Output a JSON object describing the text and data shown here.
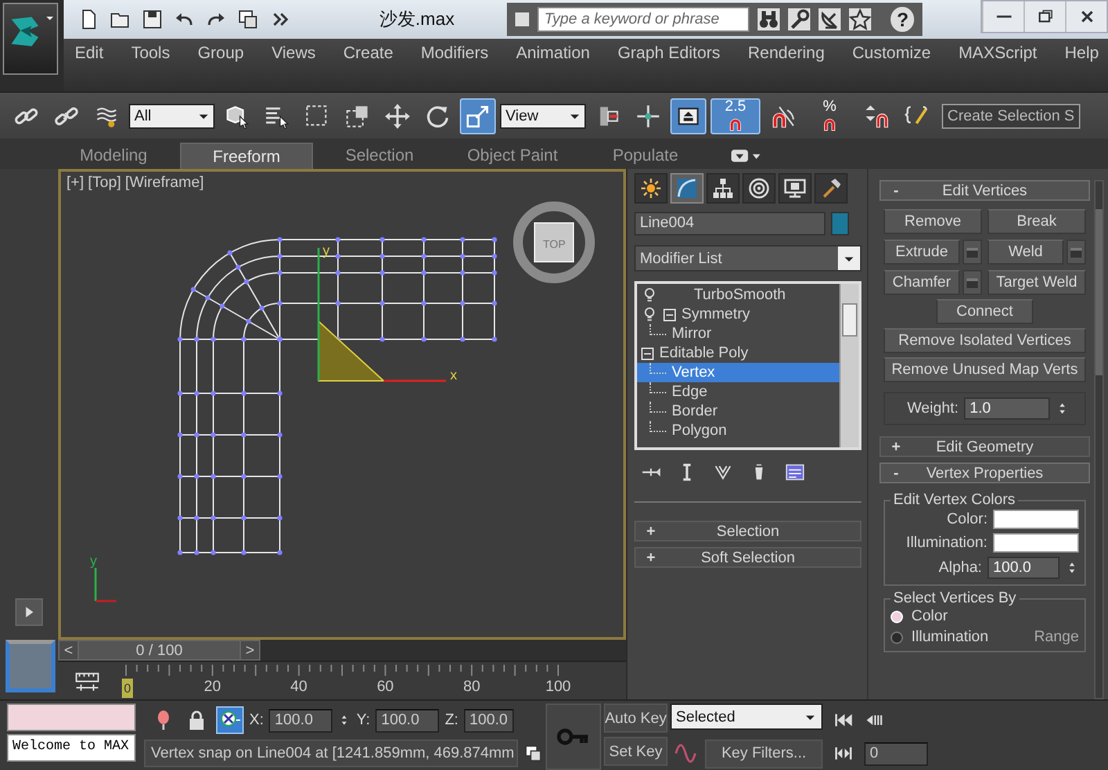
{
  "title_bar": {
    "quick_access": [
      {
        "kind": "new"
      },
      {
        "kind": "open"
      },
      {
        "kind": "save"
      },
      {
        "kind": "undo"
      },
      {
        "kind": "redo"
      },
      {
        "kind": "project"
      },
      {
        "kind": "more"
      }
    ],
    "title": "沙发.max",
    "search": {
      "placeholder": "Type a keyword or phrase"
    },
    "tools": [
      {
        "kind": "binoculars"
      },
      {
        "kind": "wrench"
      },
      {
        "kind": "satellite"
      },
      {
        "kind": "star"
      }
    ],
    "help": "?"
  },
  "menu": [
    "Edit",
    "Tools",
    "Group",
    "Views",
    "Create",
    "Modifiers",
    "Animation",
    "Graph Editors",
    "Rendering",
    "Customize",
    "MAXScript",
    "Help"
  ],
  "main_toolbar": [
    {
      "kind": "link",
      "active": false
    },
    {
      "kind": "unlink",
      "active": false
    },
    {
      "kind": "bind",
      "active": false
    },
    {
      "kind": "dropdown",
      "value": "All"
    },
    {
      "kind": "select",
      "active": false
    },
    {
      "kind": "select_by_name",
      "active": false
    },
    {
      "kind": "rect_region",
      "active": false
    },
    {
      "kind": "window_crossing",
      "active": false
    },
    {
      "kind": "move",
      "active": false
    },
    {
      "kind": "rotate",
      "active": false
    },
    {
      "kind": "scale",
      "active": true
    },
    {
      "kind": "dropdown",
      "value": "View"
    },
    {
      "kind": "pivot",
      "active": false
    },
    {
      "kind": "manipulate",
      "active": false
    },
    {
      "kind": "shortcut",
      "active": true
    },
    {
      "kind": "snap",
      "label": "2.5",
      "active": true
    },
    {
      "kind": "angle_snap",
      "active": false
    },
    {
      "kind": "percent_snap",
      "label": "%",
      "active": false
    },
    {
      "kind": "spinner_snap",
      "active": false
    },
    {
      "kind": "named_selection",
      "active": false
    },
    {
      "kind": "field",
      "value": "Create Selection S"
    }
  ],
  "ribbon": {
    "tabs": [
      {
        "label": "Modeling",
        "selected": false
      },
      {
        "label": "Freeform",
        "selected": true
      },
      {
        "label": "Selection",
        "selected": false
      },
      {
        "label": "Object Paint",
        "selected": false
      },
      {
        "label": "Populate",
        "selected": false
      }
    ]
  },
  "viewport": {
    "labels": [
      "[+]",
      "[Top]",
      "[Wireframe]"
    ],
    "viewcube": "TOP",
    "gizmo_axes": [
      "x",
      "y"
    ],
    "tripod_axis": "y"
  },
  "command_panel": {
    "tabs": [
      {
        "kind": "create",
        "selected": false
      },
      {
        "kind": "modify",
        "selected": true
      },
      {
        "kind": "hierarchy",
        "selected": false
      },
      {
        "kind": "motion",
        "selected": false
      },
      {
        "kind": "display",
        "selected": false
      },
      {
        "kind": "utilities",
        "selected": false
      }
    ],
    "object_name": "Line004",
    "modifier_list": "Modifier List",
    "stack": [
      {
        "kind": "modifier",
        "label": "TurboSmooth",
        "selected": false
      },
      {
        "kind": "modifier",
        "label": "Symmetry",
        "selected": false,
        "expanded": true,
        "children": [
          {
            "kind": "sub",
            "label": "Mirror",
            "selected": false
          }
        ]
      },
      {
        "kind": "base",
        "label": "Editable Poly",
        "selected": false,
        "expanded": true,
        "children": [
          {
            "kind": "sub",
            "label": "Vertex",
            "selected": true
          },
          {
            "kind": "sub",
            "label": "Edge",
            "selected": false
          },
          {
            "kind": "sub",
            "label": "Border",
            "selected": false
          },
          {
            "kind": "sub",
            "label": "Polygon",
            "selected": false
          }
        ]
      }
    ],
    "stack_tools": [
      {
        "kind": "pin"
      },
      {
        "kind": "ibeam"
      },
      {
        "kind": "fork"
      },
      {
        "kind": "cup"
      },
      {
        "kind": "configure"
      }
    ],
    "left_rollouts": [
      {
        "toggle": "+",
        "title": "Selection",
        "expanded": false
      },
      {
        "toggle": "+",
        "title": "Soft Selection",
        "expanded": false
      }
    ],
    "right_rollouts": [
      {
        "kind": "edit_vertices",
        "toggle": "-",
        "title": "Edit Vertices",
        "expanded": true,
        "buttons": [
          {
            "label": "Remove",
            "settings": false
          },
          {
            "label": "Break",
            "settings": false
          },
          {
            "label": "Extrude",
            "settings": true
          },
          {
            "label": "Weld",
            "settings": true
          },
          {
            "label": "Chamfer",
            "settings": true
          },
          {
            "label": "Target Weld",
            "settings": false
          }
        ],
        "wide_buttons": [
          "Connect",
          "Remove Isolated Vertices",
          "Remove Unused Map Verts"
        ],
        "weight": {
          "label": "Weight:",
          "value": "1.0"
        }
      },
      {
        "toggle": "+",
        "title": "Edit Geometry",
        "expanded": false
      },
      {
        "kind": "vertex_properties",
        "toggle": "-",
        "title": "Vertex Properties",
        "expanded": true,
        "vertex_colors": {
          "title": "Edit Vertex Colors",
          "color_label": "Color:",
          "illumination_label": "Illumination:",
          "alpha_label": "Alpha:",
          "alpha_value": "100.0"
        },
        "select_by": {
          "title": "Select Vertices By",
          "options": [
            {
              "label": "Color",
              "selected": true
            },
            {
              "label": "Illumination",
              "selected": false
            }
          ],
          "range_label": "Range"
        }
      }
    ]
  },
  "time_slider": {
    "prev": "<",
    "label": "0 / 100",
    "next": ">",
    "level": 0
  },
  "track_bar": {
    "current": "0",
    "ticks": [
      "20",
      "40",
      "60",
      "80",
      "100"
    ]
  },
  "listener": {
    "output": "Welcome to MAX"
  },
  "status": {
    "tools": [
      {
        "kind": "balloon",
        "active": false
      },
      {
        "kind": "padlock",
        "active": false
      },
      {
        "kind": "selmode",
        "active": true
      }
    ],
    "coords": [
      {
        "axis": "X:",
        "value": "100.0",
        "spinner": true
      },
      {
        "axis": "Y:",
        "value": "100.0",
        "spinner": false
      },
      {
        "axis": "Z:",
        "value": "100.0",
        "spinner": false
      }
    ],
    "prompt": "Vertex snap on Line004 at [1241.859mm, 469.874mm",
    "auto_key": "Auto Key",
    "key_mode": "Selected",
    "set_key": "Set Key",
    "key_filters": "Key Filters...",
    "frame": "0"
  }
}
